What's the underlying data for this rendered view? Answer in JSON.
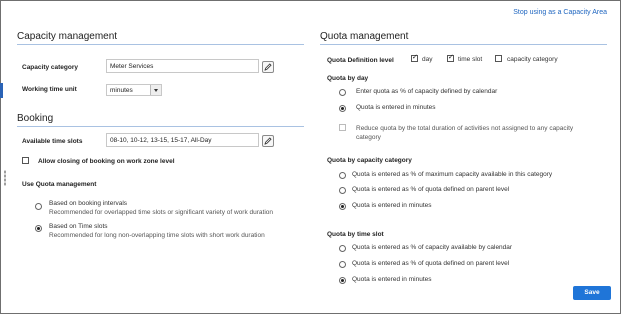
{
  "header": {
    "stop_link": "Stop using as a Capacity Area"
  },
  "capacity": {
    "title": "Capacity management",
    "category_label": "Capacity category",
    "category_value": "Meter Services",
    "unit_label": "Working time unit",
    "unit_value": "minutes"
  },
  "booking": {
    "title": "Booking",
    "slots_label": "Available time slots",
    "slots_value": "08-10, 10-12, 13-15, 15-17, All-Day",
    "allow_closing_label": "Allow closing of booking on work zone level",
    "use_quota_label": "Use Quota management",
    "opt_intervals_label": "Based on booking intervals",
    "opt_intervals_desc": "Recommended for overlapped time slots or significant variety of work duration",
    "opt_slots_label": "Based on Time slots",
    "opt_slots_desc": "Recommended for long non-overlapping time slots with short work duration"
  },
  "quota": {
    "title": "Quota management",
    "def_level_label": "Quota Definition level",
    "level_day": "day",
    "level_timeslot": "time slot",
    "level_category": "capacity category",
    "by_day": {
      "title": "Quota by day",
      "opt1": "Enter quota as % of capacity defined by calendar",
      "opt2": "Quota is entered in minutes",
      "reduce_line1": "Reduce quota by the total duration of activities not assigned to any capacity",
      "reduce_line2": "category"
    },
    "by_category": {
      "title": "Quota by capacity category",
      "opt1": "Quota is entered as % of maximum capacity available in this category",
      "opt2": "Quota is entered as % of quota defined on parent level",
      "opt3": "Quota is entered in minutes"
    },
    "by_timeslot": {
      "title": "Quota by time slot",
      "opt1": "Quota is entered as % of capacity available by calendar",
      "opt2": "Quota is entered as % of quota defined on parent level",
      "opt3": "Quota is entered in minutes"
    }
  },
  "footer": {
    "save_label": "Save"
  },
  "colors": {
    "accent": "#1f75d8",
    "link": "#1f66c0",
    "rule": "#a9c2e2"
  }
}
